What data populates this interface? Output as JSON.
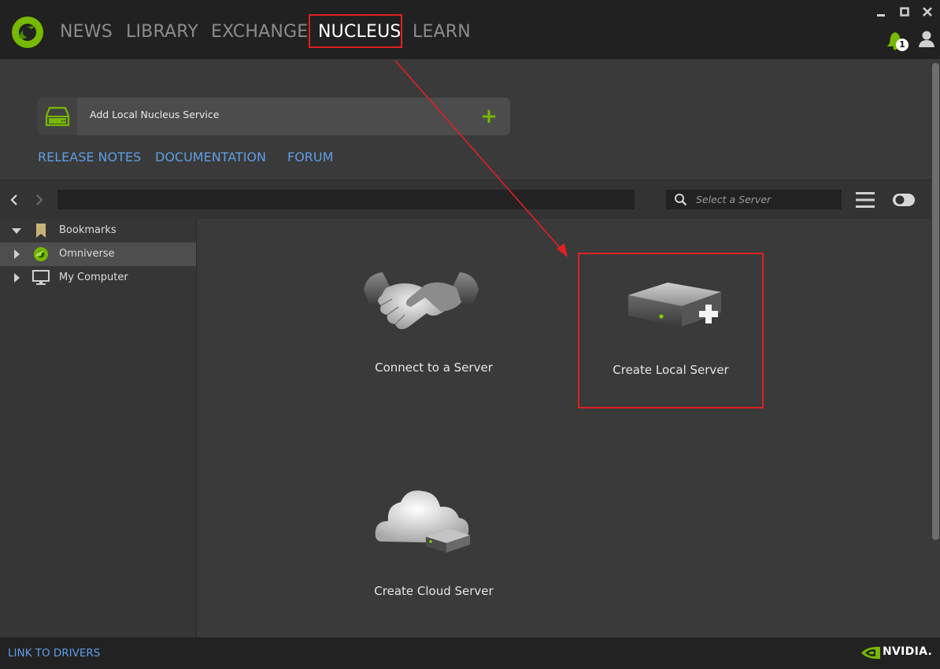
{
  "nav": {
    "tabs": [
      {
        "label": "NEWS"
      },
      {
        "label": "LIBRARY"
      },
      {
        "label": "EXCHANGE"
      },
      {
        "label": "NUCLEUS"
      },
      {
        "label": "LEARN"
      }
    ],
    "active_tab": "NUCLEUS"
  },
  "notifications": {
    "count": "1"
  },
  "service": {
    "label": "Add Local Nucleus Service",
    "add_symbol": "+"
  },
  "links": {
    "release_notes": "RELEASE NOTES",
    "documentation": "DOCUMENTATION",
    "forum": "FORUM"
  },
  "toolbar": {
    "path_value": "",
    "search_placeholder": "Select a Server"
  },
  "sidebar": {
    "items": [
      {
        "label": "Bookmarks",
        "icon": "bookmark-icon",
        "expanded": true
      },
      {
        "label": "Omniverse",
        "icon": "omniverse-icon",
        "selected": true
      },
      {
        "label": "My Computer",
        "icon": "computer-icon"
      }
    ]
  },
  "tiles": {
    "connect": {
      "label": "Connect to a Server",
      "icon": "handshake-icon"
    },
    "local": {
      "label": "Create Local Server",
      "icon": "server-add-icon"
    },
    "cloud": {
      "label": "Create Cloud Server",
      "icon": "cloud-server-icon"
    }
  },
  "footer": {
    "drivers_link": "LINK TO DRIVERS",
    "brand": "NVIDIA."
  },
  "colors": {
    "accent_green": "#76b900",
    "link_blue": "#5e9ee5",
    "highlight_red": "#e02020"
  }
}
